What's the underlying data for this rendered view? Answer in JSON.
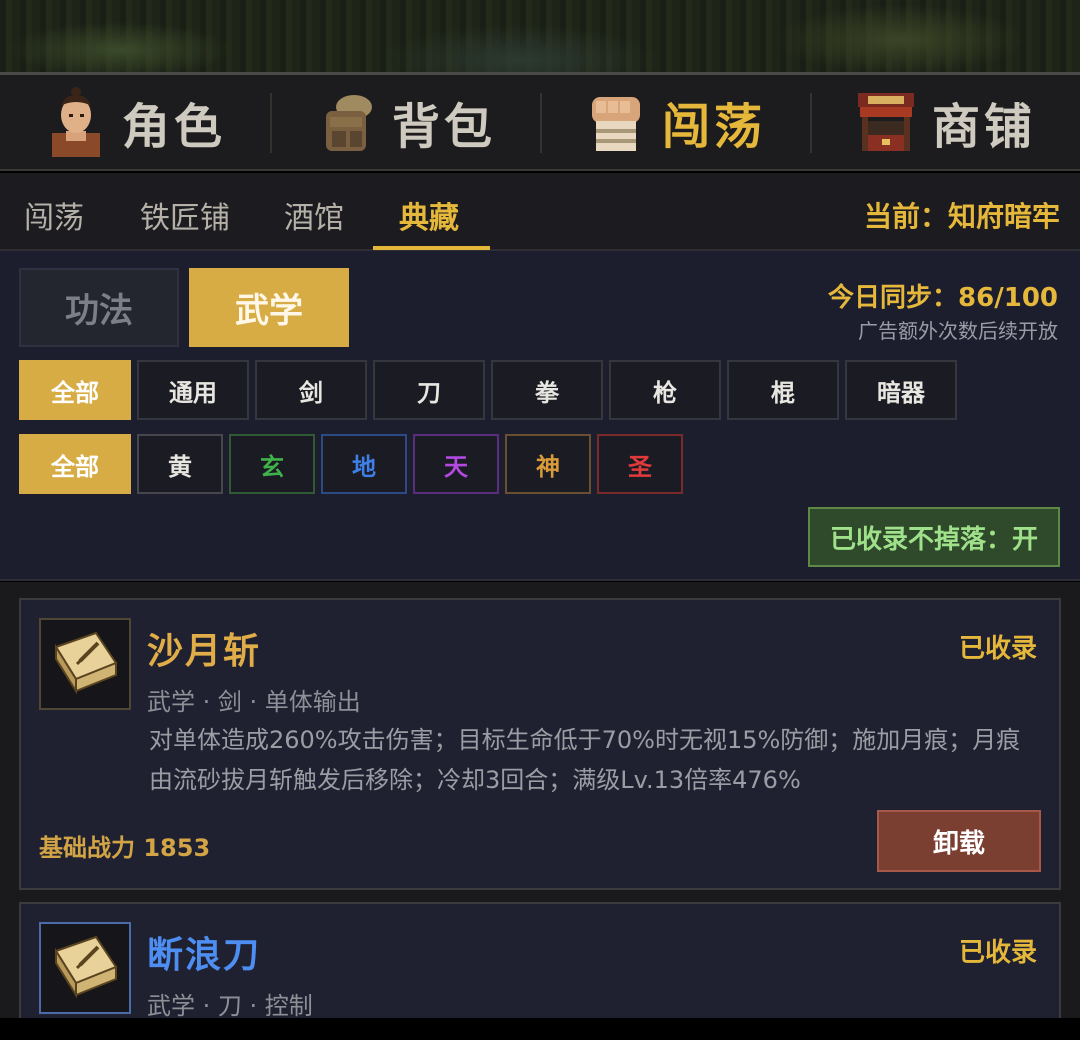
{
  "main_tabs": [
    {
      "label": "角色",
      "icon": "hero-portrait-icon",
      "active": false
    },
    {
      "label": "背包",
      "icon": "backpack-icon",
      "active": false
    },
    {
      "label": "闯荡",
      "icon": "fist-icon",
      "active": true
    },
    {
      "label": "商铺",
      "icon": "shop-stall-icon",
      "active": false
    }
  ],
  "sub_tabs": [
    {
      "label": "闯荡",
      "active": false
    },
    {
      "label": "铁匠铺",
      "active": false
    },
    {
      "label": "酒馆",
      "active": false
    },
    {
      "label": "典藏",
      "active": true
    }
  ],
  "location": "当前：知府暗牢",
  "mode_tabs": [
    {
      "label": "功法",
      "active": false
    },
    {
      "label": "武学",
      "active": true
    }
  ],
  "sync": {
    "text": "今日同步：86/100",
    "note": "广告额外次数后续开放"
  },
  "type_filters": [
    {
      "label": "全部",
      "active": true
    },
    {
      "label": "通用"
    },
    {
      "label": "剑"
    },
    {
      "label": "刀"
    },
    {
      "label": "拳"
    },
    {
      "label": "枪"
    },
    {
      "label": "棍"
    },
    {
      "label": "暗器"
    }
  ],
  "grade_filters": [
    {
      "label": "全部",
      "active": true,
      "color": "#ffffff"
    },
    {
      "label": "黄",
      "color": "#e8e6e0",
      "border": "#45464e"
    },
    {
      "label": "玄",
      "color": "#3fb24a",
      "border": "#2f5a34"
    },
    {
      "label": "地",
      "color": "#3f7fe8",
      "border": "#2e4a86"
    },
    {
      "label": "天",
      "color": "#b04ae0",
      "border": "#5a2f80"
    },
    {
      "label": "神",
      "color": "#d89a3a",
      "border": "#6a5030"
    },
    {
      "label": "圣",
      "color": "#e03a3a",
      "border": "#7a2a2a"
    }
  ],
  "toggle_label": "已收录不掉落：开",
  "cards": [
    {
      "name": "沙月斩",
      "status": "已收录",
      "tags": "武学 · 剑 · 单体输出",
      "desc": "对单体造成260%攻击伤害；目标生命低于70%时无视15%防御；施加月痕；月痕由流砂拔月斩触发后移除；冷却3回合；满级Lv.13倍率476%",
      "power": "基础战力 1853",
      "action": "卸载",
      "name_color": "gold"
    },
    {
      "name": "断浪刀",
      "status": "已收录",
      "tags": "武学 · 刀 · 控制",
      "name_color": "blue"
    }
  ]
}
